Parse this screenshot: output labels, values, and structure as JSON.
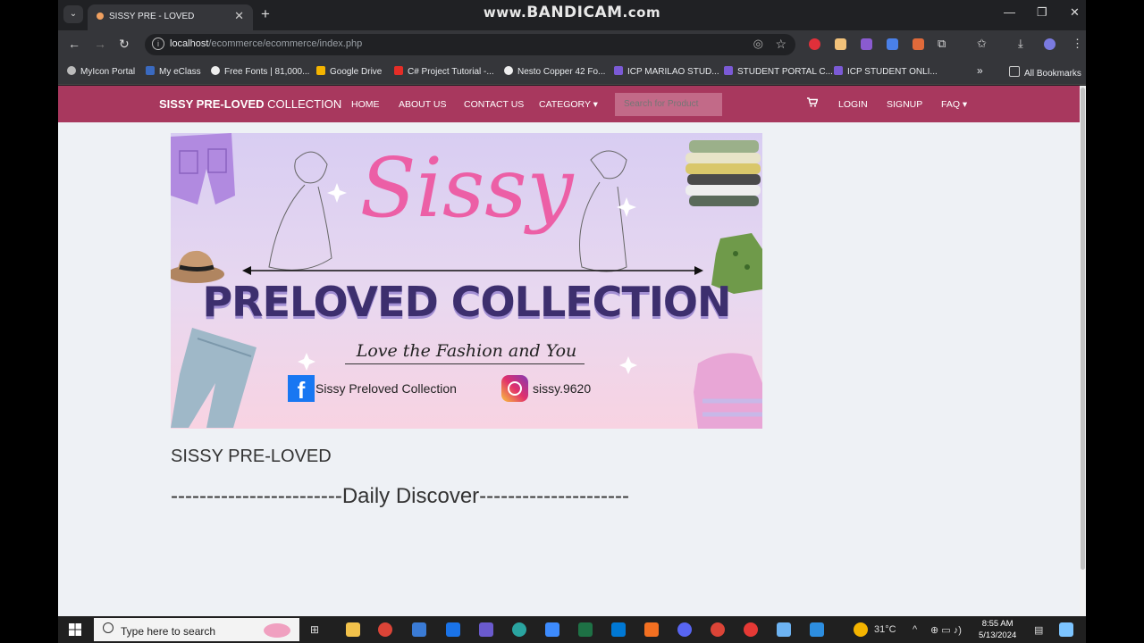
{
  "watermark": {
    "prefix": "www.",
    "brand": "BANDICAM",
    "suffix": ".com"
  },
  "browser": {
    "tab_title": "SISSY PRE - LOVED",
    "url_host": "localhost",
    "url_path": "/ecommerce/ecommerce/index.php",
    "bookmarks": [
      "MyIcon Portal",
      "My eClass",
      "Free Fonts | 81,000...",
      "Google Drive",
      "C# Project Tutorial -...",
      "Nesto Copper 42 Fo...",
      "ICP MARILAO STUD...",
      "STUDENT PORTAL C...",
      "ICP STUDENT ONLI..."
    ],
    "all_bookmarks": "All Bookmarks",
    "more_bookmarks": "»"
  },
  "site": {
    "brand_bold": "SISSY PRE-LOVED",
    "brand_rest": "COLLECTION",
    "nav": {
      "home": "HOME",
      "about": "ABOUT US",
      "contact": "CONTACT US",
      "category": "CATEGORY ▾",
      "login": "LOGIN",
      "signup": "SIGNUP",
      "faq": "FAQ ▾"
    },
    "search_placeholder": "Search for Product",
    "accent_color": "#a8385e",
    "banner": {
      "script_title": "Sissy",
      "title": "PRELOVED COLLECTION",
      "tagline": "Love the Fashion and You",
      "facebook": "Sissy Preloved Collection",
      "instagram": "sissy.9620"
    },
    "heading": "SISSY PRE-LOVED",
    "section": "------------------------Daily Discover---------------------"
  },
  "taskbar": {
    "search_placeholder": "Type here to search",
    "weather": "31°C",
    "time": "8:55 AM",
    "date": "5/13/2024"
  }
}
